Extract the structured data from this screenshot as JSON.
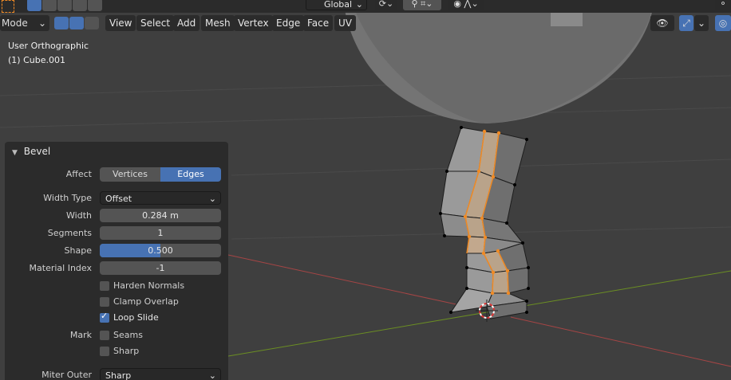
{
  "header": {
    "mode": "Mode",
    "menus": [
      "View",
      "Select",
      "Add",
      "Mesh",
      "Vertex",
      "Edge",
      "Face",
      "UV"
    ],
    "transform_orientation": "Global"
  },
  "viewport": {
    "view_name": "User Orthographic",
    "object_name": "(1) Cube.001"
  },
  "panel": {
    "title": "Bevel",
    "affect_label": "Affect",
    "affect_options": [
      "Vertices",
      "Edges"
    ],
    "affect_selected": "Edges",
    "width_type_label": "Width Type",
    "width_type_value": "Offset",
    "width_label": "Width",
    "width_value": "0.284 m",
    "segments_label": "Segments",
    "segments_value": "1",
    "shape_label": "Shape",
    "shape_value": "0.500",
    "shape_fraction": 0.5,
    "material_index_label": "Material Index",
    "material_index_value": "-1",
    "harden_normals": "Harden Normals",
    "clamp_overlap": "Clamp Overlap",
    "loop_slide": "Loop Slide",
    "mark_label": "Mark",
    "seams": "Seams",
    "sharp": "Sharp",
    "miter_outer_label": "Miter Outer",
    "miter_outer_value": "Sharp"
  },
  "colors": {
    "accent": "#4772b3",
    "selection": "#f08a24",
    "x_axis": "#b34545",
    "y_axis": "#6b8e23"
  }
}
